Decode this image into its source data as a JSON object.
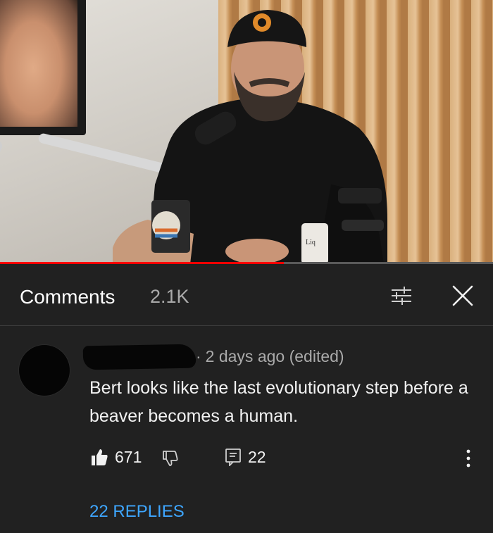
{
  "video": {
    "progress_fraction": 0.575,
    "progress_color": "#ff0000"
  },
  "comments_panel": {
    "title": "Comments",
    "count": "2.1K",
    "filter_icon": "sort-filter-icon",
    "close_icon": "close-icon"
  },
  "comment": {
    "author": "",
    "time": "2 days ago (edited)",
    "text": "Bert looks like the last evolutionary step before a beaver becomes a human.",
    "likes": "671",
    "replies_count": "22",
    "replies_link": "22 REPLIES",
    "icons": [
      "thumbs-up-icon",
      "thumbs-down-icon",
      "reply-icon",
      "more-vertical-icon"
    ],
    "link_color": "#3ea6ff"
  }
}
